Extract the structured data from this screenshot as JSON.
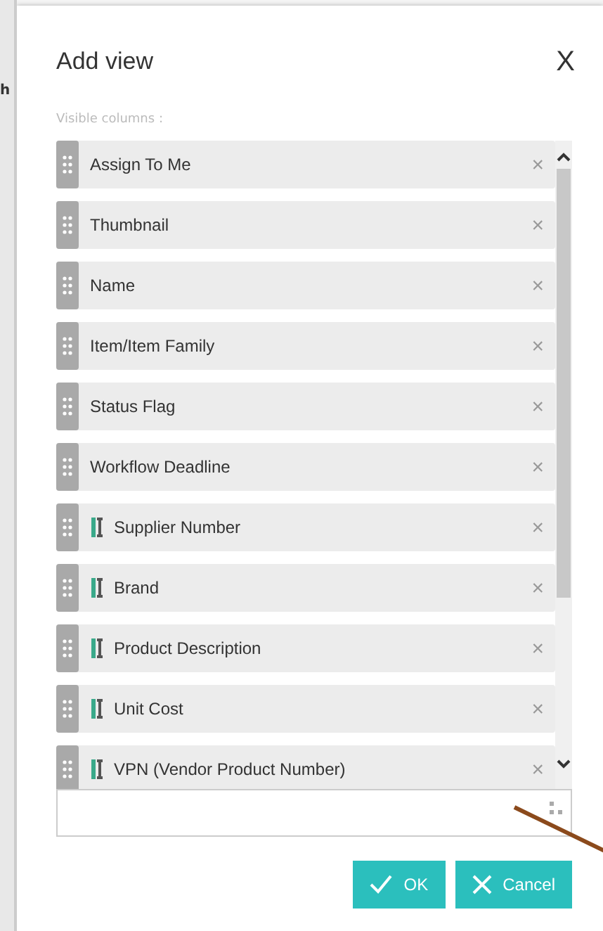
{
  "background_fragment": "h",
  "dialog": {
    "title": "Add view",
    "close": "X",
    "section_label": "Visible columns :"
  },
  "columns": [
    {
      "kind": "plain",
      "label": "Assign To Me",
      "remove": "×"
    },
    {
      "kind": "plain",
      "label": "Thumbnail",
      "remove": "×"
    },
    {
      "kind": "plain",
      "label": "Name",
      "remove": "×"
    },
    {
      "kind": "plain",
      "label": "Item/Item Family",
      "remove": "×"
    },
    {
      "kind": "plain",
      "label": "Status Flag",
      "remove": "×"
    },
    {
      "kind": "plain",
      "label": "Workflow Deadline",
      "remove": "×"
    },
    {
      "kind": "attribute",
      "label": "Supplier Number",
      "remove": "×"
    },
    {
      "kind": "attribute",
      "label": "Brand",
      "remove": "×"
    },
    {
      "kind": "attribute",
      "label": "Product Description",
      "remove": "×"
    },
    {
      "kind": "attribute",
      "label": "Unit Cost",
      "remove": "×"
    },
    {
      "kind": "attribute",
      "label": "VPN (Vendor Product Number)",
      "remove": "×"
    }
  ],
  "buttons": [
    {
      "kind": "ok",
      "label": "OK"
    },
    {
      "kind": "cancel",
      "label": "Cancel"
    }
  ]
}
